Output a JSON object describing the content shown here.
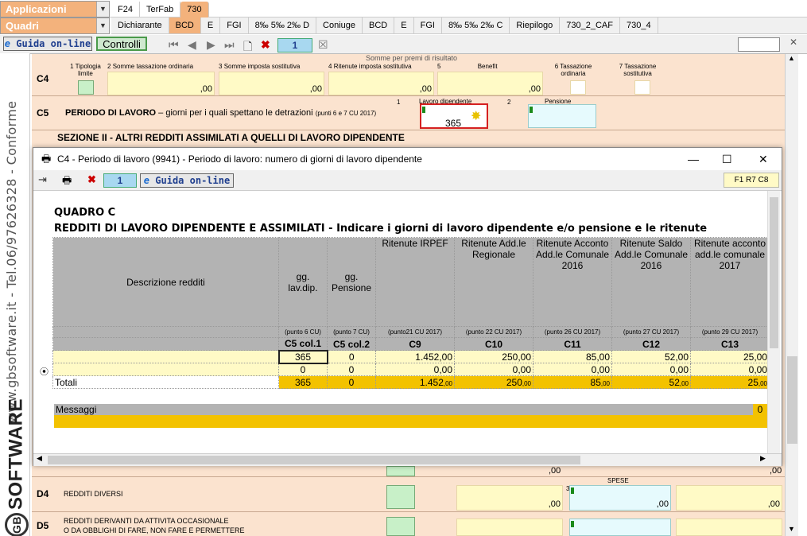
{
  "top": {
    "applicazioni": "Applicazioni",
    "quadri": "Quadri",
    "row1_tabs": [
      "F24",
      "TerFab",
      "730"
    ],
    "row2_tabs": [
      "Dichiarante",
      "BCD",
      "E",
      "FGI",
      "8‰ 5‰ 2‰ D",
      "Coniuge",
      "BCD",
      "E",
      "FGI",
      "8‰ 5‰ 2‰ C",
      "Riepilogo",
      "730_2_CAF",
      "730_4"
    ]
  },
  "toolbar": {
    "guida": "Guida on-line",
    "controlli": "Controlli",
    "page": "1"
  },
  "sidebar": {
    "text": "www.gbsoftware.it - Tel.06/97626328 - Conforme",
    "brand": "SOFTWARE",
    "brand_gb": "GB"
  },
  "form": {
    "partial_heading": "Somme per premi di risultato",
    "c4": {
      "code": "C4",
      "cols": [
        {
          "n": "1",
          "label": "Tipologia limite"
        },
        {
          "n": "2",
          "label": "Somme tassazione ordinaria"
        },
        {
          "n": "3",
          "label": "Somme imposta sostitutiva"
        },
        {
          "n": "4",
          "label": "Ritenute imposta sostitutiva"
        },
        {
          "n": "5",
          "label": "Benefit"
        },
        {
          "n": "6",
          "label": "Tassazione ordinaria"
        },
        {
          "n": "7",
          "label": "Tassazione sostitutiva"
        }
      ],
      "cents": ",00"
    },
    "c5": {
      "code": "C5",
      "label": "PERIODO DI LAVORO",
      "label_rest": "– giorni per i quali spettano le detrazioni",
      "note": "(punti 6 e 7 CU 2017)",
      "col1_n": "1",
      "col1": "Lavoro dipendente",
      "col1_value": "365",
      "col2_n": "2",
      "col2": "Pensione"
    },
    "sezione": "SEZIONE II - ALTRI REDDITI ASSIMILATI A QUELLI DI LAVORO DIPENDENTE",
    "d_top_cents": ",00",
    "d4": {
      "code": "D4",
      "label": "REDDITI DIVERSI",
      "spese": "SPESE",
      "field_n": "3",
      "cents": ",00"
    },
    "d5": {
      "code": "D5",
      "label1": "REDDITI DERIVANTI DA ATTIVITA OCCASIONALE",
      "label2": "O DA OBBLIGHI DI FARE, NON FARE E PERMETTERE"
    }
  },
  "modal": {
    "title": "C4 - Periodo di lavoro (9941) - Periodo di lavoro: numero di giorni di lavoro dipendente",
    "page": "1",
    "guida": "Guida on-line",
    "f1": "F1 R7 C8",
    "quadro": "QUADRO C",
    "heading": "REDDITI DI LAVORO DIPENDENTE E ASSIMILATI",
    "heading_rest": " - Indicare i giorni di lavoro dipendente e/o pensione e le ritenute",
    "columns": [
      {
        "title": "Descrizione redditi",
        "punto": "",
        "code": ""
      },
      {
        "title": "gg. lav.dip.",
        "punto": "(punto 6 CU)",
        "code": "C5 col.1"
      },
      {
        "title": "gg. Pensione",
        "punto": "(punto 7 CU)",
        "code": "C5 col.2"
      },
      {
        "title": "Ritenute IRPEF",
        "punto": "(punto21 CU 2017)",
        "code": "C9"
      },
      {
        "title": "Ritenute Add.le Regionale",
        "punto": "(punto 22 CU 2017)",
        "code": "C10"
      },
      {
        "title": "Ritenute Acconto Add.le Comunale 2016",
        "punto": "(punto 26 CU 2017)",
        "code": "C11"
      },
      {
        "title": "Ritenute Saldo Add.le Comunale 2016",
        "punto": "(punto 27 CU 2017)",
        "code": "C12"
      },
      {
        "title": "Ritenute acconto add.le comunale 2017",
        "punto": "(punto 29 CU 2017)",
        "code": "C13"
      }
    ],
    "rows": [
      [
        "",
        "365",
        "0",
        "1.452,00",
        "250,00",
        "85,00",
        "52,00",
        "25,00"
      ],
      [
        "",
        "0",
        "0",
        "0,00",
        "0,00",
        "0,00",
        "0,00",
        "0,00"
      ]
    ],
    "totals": [
      "Totali",
      "365",
      "0",
      "1.452",
      "250",
      "85",
      "52",
      "25"
    ],
    "totals_cents": ",00",
    "messaggi": "Messaggi",
    "messaggi_count": "0"
  }
}
